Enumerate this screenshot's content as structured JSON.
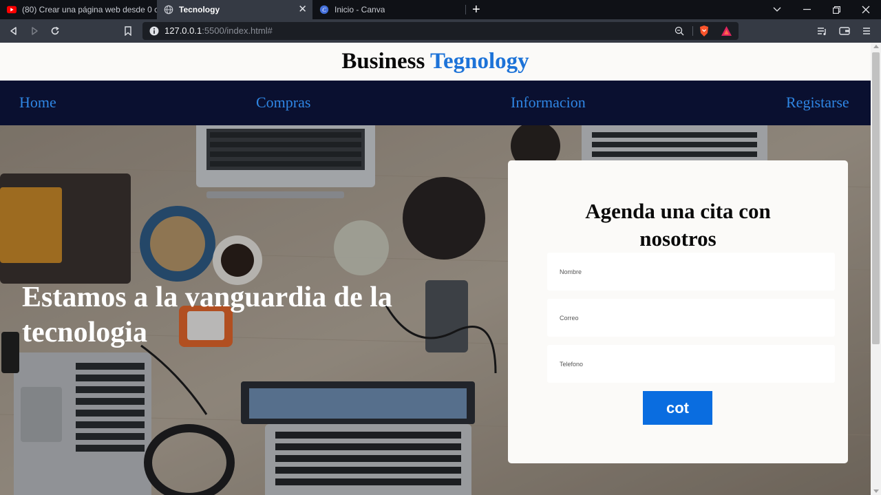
{
  "browser": {
    "tabs": [
      {
        "title": "(80) Crear una página web desde 0 co",
        "icon": "youtube-icon"
      },
      {
        "title": "Tecnology",
        "icon": "globe-icon",
        "active": true
      },
      {
        "title": "Inicio - Canva",
        "icon": "canva-icon"
      }
    ],
    "url": {
      "host": "127.0.0.1",
      "rest": ":5500/index.html#"
    }
  },
  "site": {
    "brand": {
      "part1": "Business",
      "part2": "Tegnology"
    },
    "nav": [
      "Home",
      "Compras",
      "Informacion",
      "Registarse"
    ],
    "hero_title": "Estamos a la vanguardia de la tecnologia",
    "form": {
      "title": "Agenda una cita con nosotros",
      "fields": [
        {
          "placeholder": "Nombre"
        },
        {
          "placeholder": "Correo"
        },
        {
          "placeholder": "Telefono"
        }
      ],
      "submit_label": "cot"
    }
  },
  "colors": {
    "brand_accent": "#1d73d8",
    "nav_background": "#0a1030",
    "nav_link": "#2f86e4",
    "button": "#0a6de0"
  }
}
